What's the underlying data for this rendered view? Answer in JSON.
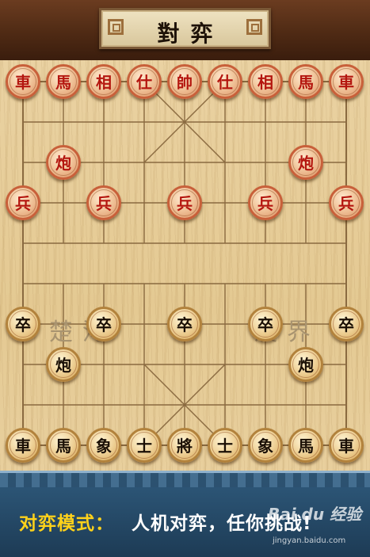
{
  "title": "對弈",
  "river": {
    "left": "楚河",
    "right": "漢界"
  },
  "pieces": [
    {
      "label": "車",
      "side": "red",
      "col": 0,
      "row": 0
    },
    {
      "label": "馬",
      "side": "red",
      "col": 1,
      "row": 0
    },
    {
      "label": "相",
      "side": "red",
      "col": 2,
      "row": 0
    },
    {
      "label": "仕",
      "side": "red",
      "col": 3,
      "row": 0
    },
    {
      "label": "帥",
      "side": "red",
      "col": 4,
      "row": 0
    },
    {
      "label": "仕",
      "side": "red",
      "col": 5,
      "row": 0
    },
    {
      "label": "相",
      "side": "red",
      "col": 6,
      "row": 0
    },
    {
      "label": "馬",
      "side": "red",
      "col": 7,
      "row": 0
    },
    {
      "label": "車",
      "side": "red",
      "col": 8,
      "row": 0
    },
    {
      "label": "炮",
      "side": "red",
      "col": 1,
      "row": 2
    },
    {
      "label": "炮",
      "side": "red",
      "col": 7,
      "row": 2
    },
    {
      "label": "兵",
      "side": "red",
      "col": 0,
      "row": 3
    },
    {
      "label": "兵",
      "side": "red",
      "col": 2,
      "row": 3
    },
    {
      "label": "兵",
      "side": "red",
      "col": 4,
      "row": 3
    },
    {
      "label": "兵",
      "side": "red",
      "col": 6,
      "row": 3
    },
    {
      "label": "兵",
      "side": "red",
      "col": 8,
      "row": 3
    },
    {
      "label": "卒",
      "side": "black",
      "col": 0,
      "row": 6
    },
    {
      "label": "卒",
      "side": "black",
      "col": 2,
      "row": 6
    },
    {
      "label": "卒",
      "side": "black",
      "col": 4,
      "row": 6
    },
    {
      "label": "卒",
      "side": "black",
      "col": 6,
      "row": 6
    },
    {
      "label": "卒",
      "side": "black",
      "col": 8,
      "row": 6
    },
    {
      "label": "炮",
      "side": "black",
      "col": 1,
      "row": 7
    },
    {
      "label": "炮",
      "side": "black",
      "col": 7,
      "row": 7
    },
    {
      "label": "車",
      "side": "black",
      "col": 0,
      "row": 9
    },
    {
      "label": "馬",
      "side": "black",
      "col": 1,
      "row": 9
    },
    {
      "label": "象",
      "side": "black",
      "col": 2,
      "row": 9
    },
    {
      "label": "士",
      "side": "black",
      "col": 3,
      "row": 9
    },
    {
      "label": "將",
      "side": "black",
      "col": 4,
      "row": 9
    },
    {
      "label": "士",
      "side": "black",
      "col": 5,
      "row": 9
    },
    {
      "label": "象",
      "side": "black",
      "col": 6,
      "row": 9
    },
    {
      "label": "馬",
      "side": "black",
      "col": 7,
      "row": 9
    },
    {
      "label": "車",
      "side": "black",
      "col": 8,
      "row": 9
    }
  ],
  "banner": {
    "mode_label": "对弈模式：",
    "mode_text": "人机对弈，任你挑战!"
  },
  "watermark": {
    "brand": "Bai du 经验",
    "url": "jingyan.baidu.com"
  },
  "colors": {
    "header_wood": "#4f2a14",
    "board": "#e4c992",
    "board_lines": "#8a6a40",
    "red_piece_text": "#b4160f",
    "black_piece_text": "#1a0f05",
    "banner_bg": "#1d3b55",
    "banner_label": "#ffd21a",
    "banner_text": "#ffffff"
  }
}
